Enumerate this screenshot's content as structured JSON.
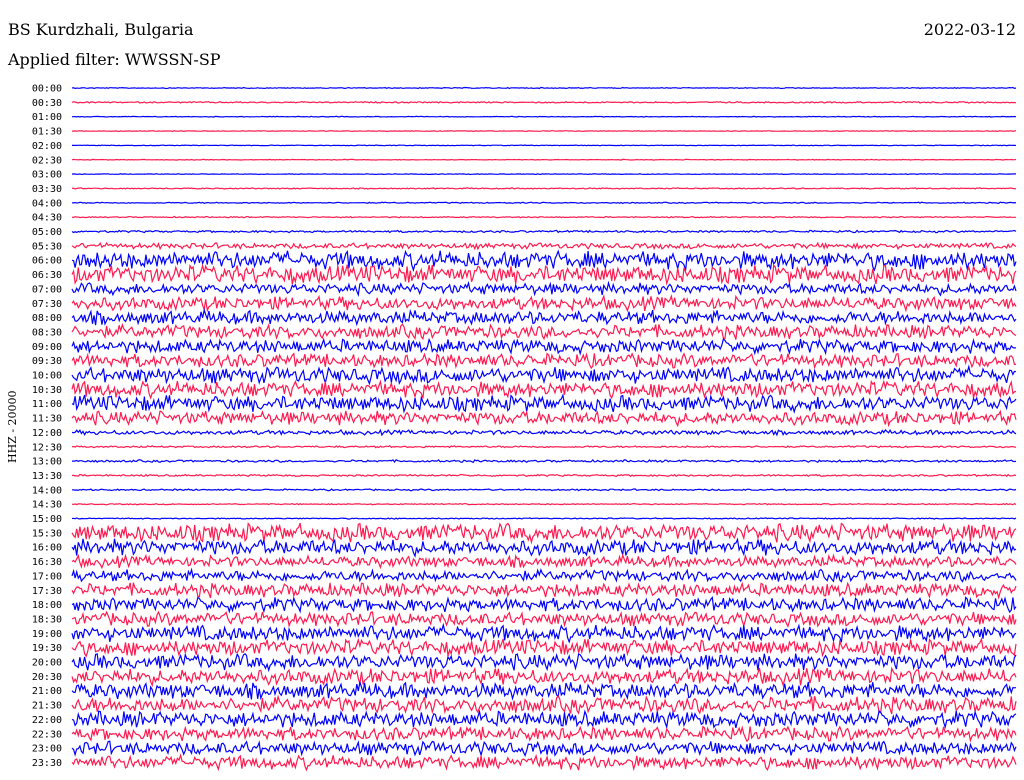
{
  "header": {
    "station": "BS Kurdzhali, Bulgaria",
    "date": "2022-03-12",
    "filter_text": "Applied filter: WWSSN-SP"
  },
  "chart_data": {
    "type": "line",
    "title": "BS Kurdzhali, Bulgaria",
    "ylabel": "HHZ - 20000",
    "colors": {
      "even": "#0000ff",
      "odd": "#ff1a4f"
    },
    "rows": [
      {
        "time": "00:00",
        "amp": 0.4
      },
      {
        "time": "00:30",
        "amp": 0.6
      },
      {
        "time": "01:00",
        "amp": 0.3
      },
      {
        "time": "01:30",
        "amp": 0.3
      },
      {
        "time": "02:00",
        "amp": 0.3
      },
      {
        "time": "02:30",
        "amp": 0.3
      },
      {
        "time": "03:00",
        "amp": 0.3
      },
      {
        "time": "03:30",
        "amp": 0.5
      },
      {
        "time": "04:00",
        "amp": 0.5
      },
      {
        "time": "04:30",
        "amp": 0.5
      },
      {
        "time": "05:00",
        "amp": 0.9
      },
      {
        "time": "05:30",
        "amp": 2.5
      },
      {
        "time": "06:00",
        "amp": 8
      },
      {
        "time": "06:30",
        "amp": 8
      },
      {
        "time": "07:00",
        "amp": 5
      },
      {
        "time": "07:30",
        "amp": 6
      },
      {
        "time": "08:00",
        "amp": 6
      },
      {
        "time": "08:30",
        "amp": 6
      },
      {
        "time": "09:00",
        "amp": 6
      },
      {
        "time": "09:30",
        "amp": 6
      },
      {
        "time": "10:00",
        "amp": 7
      },
      {
        "time": "10:30",
        "amp": 7
      },
      {
        "time": "11:00",
        "amp": 7
      },
      {
        "time": "11:30",
        "amp": 6
      },
      {
        "time": "12:00",
        "amp": 2
      },
      {
        "time": "12:30",
        "amp": 0.8
      },
      {
        "time": "13:00",
        "amp": 1
      },
      {
        "time": "13:30",
        "amp": 0.8
      },
      {
        "time": "14:00",
        "amp": 0.7
      },
      {
        "time": "14:30",
        "amp": 0.5
      },
      {
        "time": "15:00",
        "amp": 0.5
      },
      {
        "time": "15:30",
        "amp": 8
      },
      {
        "time": "16:00",
        "amp": 7
      },
      {
        "time": "16:30",
        "amp": 5
      },
      {
        "time": "17:00",
        "amp": 5
      },
      {
        "time": "17:30",
        "amp": 6
      },
      {
        "time": "18:00",
        "amp": 6
      },
      {
        "time": "18:30",
        "amp": 6
      },
      {
        "time": "19:00",
        "amp": 7
      },
      {
        "time": "19:30",
        "amp": 7
      },
      {
        "time": "20:00",
        "amp": 7
      },
      {
        "time": "20:30",
        "amp": 7
      },
      {
        "time": "21:00",
        "amp": 7
      },
      {
        "time": "21:30",
        "amp": 7
      },
      {
        "time": "22:00",
        "amp": 7
      },
      {
        "time": "22:30",
        "amp": 6
      },
      {
        "time": "23:00",
        "amp": 6
      },
      {
        "time": "23:30",
        "amp": 6
      }
    ]
  }
}
